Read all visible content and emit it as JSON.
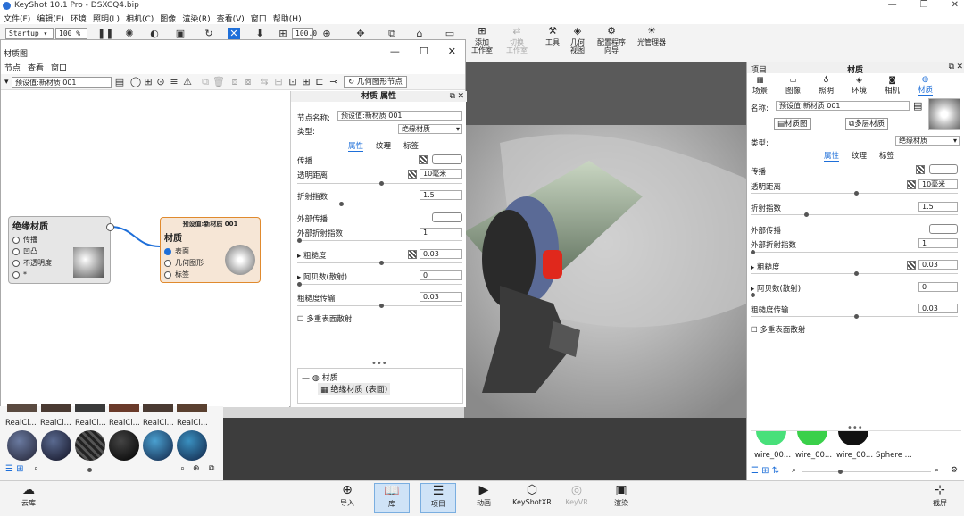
{
  "app": {
    "title": "KeyShot 10.1 Pro - DSXCQ4.bip",
    "window_controls": [
      "—",
      "❐",
      "✕"
    ]
  },
  "menu": [
    "文件(F)",
    "编辑(E)",
    "环境",
    "照明(L)",
    "相机(C)",
    "图像",
    "渲染(R)",
    "查看(V)",
    "窗口",
    "帮助(H)"
  ],
  "toolbar": {
    "workspace": "Startup ▾",
    "zoom": "100 % ▾",
    "res": "100.0",
    "add_studio": "添加\n工作室",
    "switch_studio": "切换\n工作室",
    "tools": "工具",
    "geometry_view": "几何\n视图",
    "configurator": "配置程序\n向导",
    "light_manager": "光管理器"
  },
  "mat_window": {
    "title": "材质图",
    "menu": [
      "节点",
      "查看",
      "窗口"
    ],
    "preset": "预设值:新材质 001",
    "geom_node_btn": "几何图形节点",
    "controls": [
      "—",
      "☐",
      "✕"
    ]
  },
  "node_insulator": {
    "title": "绝缘材质",
    "ports": [
      "传播",
      "凹凸",
      "不透明度",
      "*"
    ]
  },
  "node_material": {
    "header": "预设值:新材质 001",
    "title": "材质",
    "ports": [
      "表面",
      "几何图形",
      "标签"
    ]
  },
  "props": {
    "header": "材质 属性",
    "name_label": "节点名称:",
    "name": "预设值:新材质 001",
    "type_label": "类型:",
    "type": "绝缘材质",
    "tabs": [
      "属性",
      "纹理",
      "标签"
    ],
    "rows": {
      "transmission": "传播",
      "trans_dist": "透明距离",
      "trans_dist_val": "10毫米",
      "ior": "折射指数",
      "ior_val": "1.5",
      "ext_trans": "外部传播",
      "ext_ior": "外部折射指数",
      "ext_ior_val": "1",
      "rough": "粗糙度",
      "rough_val": "0.03",
      "abbe": "阿贝数(散射)",
      "abbe_val": "0",
      "rough_trans": "粗糙度传输",
      "rough_trans_val": "0.03",
      "multi": "多重表面散射"
    },
    "tree_root": "材质",
    "tree_child": "绝缘材质 (表面)"
  },
  "library": {
    "labels": [
      "RealCl...",
      "RealCl...",
      "RealCl...",
      "RealCl...",
      "RealCl...",
      "RealCl..."
    ]
  },
  "right": {
    "title_left": "项目",
    "title": "材质",
    "tabs": [
      "场景",
      "图像",
      "照明",
      "环境",
      "相机",
      "材质"
    ],
    "name_label": "名称:",
    "name": "预设值:新材质 001",
    "mat_graph_btn": "材质图",
    "multi_btn": "多层材质",
    "type_label": "类型:",
    "type": "绝缘材质",
    "subtabs": [
      "属性",
      "纹理",
      "标签"
    ],
    "thumbs": [
      "wire_00...",
      "wire_00...",
      "wire_00...",
      "Sphere ..."
    ]
  },
  "bottom": {
    "cloud": "云库",
    "import": "导入",
    "library": "库",
    "project": "项目",
    "animation": "动画",
    "xr": "KeyShotXR",
    "vr": "KeyVR",
    "render": "渲染",
    "screenshot": "截屏"
  },
  "colors": {
    "accent": "#1e6fd9",
    "node_orange": "#e08a2e"
  }
}
